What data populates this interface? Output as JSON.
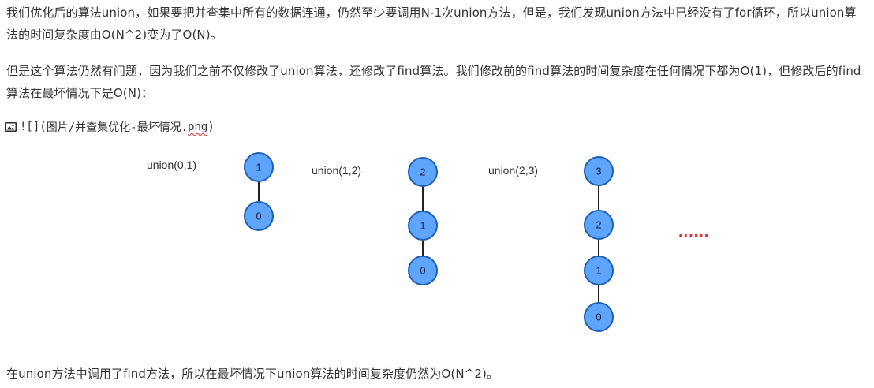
{
  "paragraphs": {
    "p1": "我们优化后的算法union，如果要把并查集中所有的数据连通，仍然至少要调用N-1次union方法，但是，我们发现union方法中已经没有了for循环，所以union算法的时间复杂度由O(N^2)变为了O(N)。",
    "p2": "但是这个算法仍然有问题，因为我们之前不仅修改了union算法，还修改了find算法。我们修改前的find算法的时间复杂度在任何情况下都为O(1)，但修改后的find算法在最坏情况下是O(N)：",
    "p3": "在union方法中调用了find方法，所以在最坏情况下union算法的时间复杂度仍然为O(N^2)。"
  },
  "image_ref": {
    "prefix": "![](",
    "path_main": "图片/并查集优化-最坏情况.",
    "ext": "png",
    "suffix": ")"
  },
  "diagram": {
    "groups": [
      {
        "label": "union(0,1)",
        "nodes": [
          "1",
          "0"
        ]
      },
      {
        "label": "union(1,2)",
        "nodes": [
          "2",
          "1",
          "0"
        ]
      },
      {
        "label": "union(2,3)",
        "nodes": [
          "3",
          "2",
          "1",
          "0"
        ]
      }
    ],
    "ellipsis": "......",
    "colors": {
      "node_fill": "#5ea5ff",
      "node_stroke": "#1f5fb0",
      "edge": "#222222",
      "ellipsis": "#e03030"
    }
  }
}
